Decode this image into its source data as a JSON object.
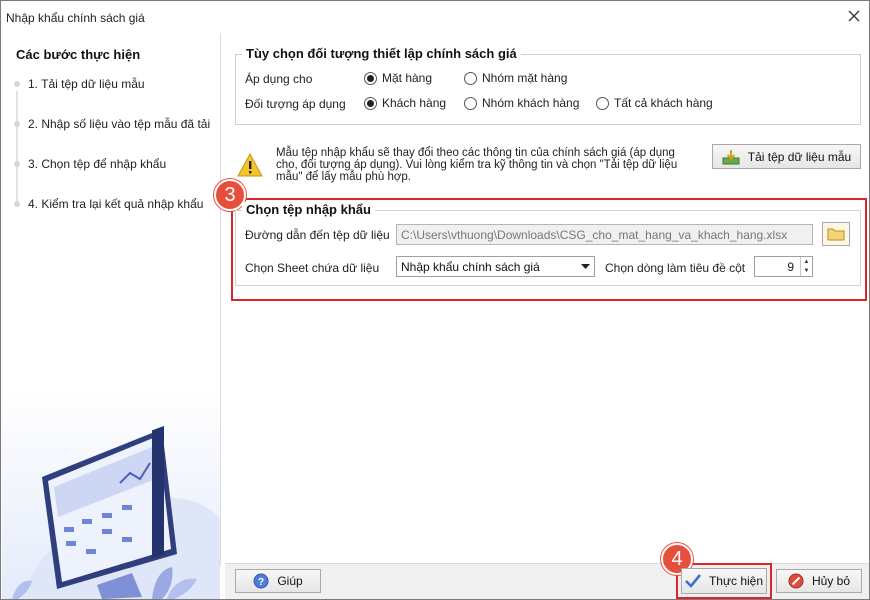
{
  "window": {
    "title": "Nhập khẩu chính sách giá"
  },
  "steps": {
    "title": "Các bước thực hiện",
    "items": [
      "1. Tải tệp dữ liệu mẫu",
      "2. Nhập số liệu vào tệp mẫu đã tải",
      "3. Chọn tệp để nhập khẩu",
      "4. Kiểm tra lại kết quả nhập khẩu"
    ]
  },
  "options": {
    "legend": "Tùy chọn đối tượng thiết lập chính sách giá",
    "apply_label": "Áp dụng cho",
    "apply_choices": [
      "Mặt hàng",
      "Nhóm mặt hàng"
    ],
    "target_label": "Đối tượng áp dụng",
    "target_choices": [
      "Khách hàng",
      "Nhóm khách hàng",
      "Tất cả khách hàng"
    ]
  },
  "notice": {
    "text": "Mẫu tệp nhập khẩu sẽ thay đổi theo các thông tin của chính sách giá (áp dụng cho, đối tượng áp dụng). Vui lòng kiểm tra kỹ thông tin và chọn \"Tải tệp dữ liệu mẫu\" để lấy mẫu phù hợp.",
    "download_button": "Tải tệp dữ liệu mẫu"
  },
  "file_select": {
    "legend": "Chọn tệp nhập khẩu",
    "path_label": "Đường dẫn đến tệp dữ liệu",
    "path_value": "C:\\Users\\vthuong\\Downloads\\CSG_cho_mat_hang_va_khach_hang.xlsx",
    "sheet_label": "Chọn Sheet chứa dữ liệu",
    "sheet_value": "Nhập khẩu chính sách giá",
    "header_row_label": "Chọn dòng làm tiêu đề cột",
    "header_row_value": "9"
  },
  "badges": {
    "step3": "3",
    "step4": "4"
  },
  "footer": {
    "help_button": "Giúp",
    "execute_button": "Thực hiện",
    "cancel_button": "Hủy bỏ"
  },
  "colors": {
    "highlight_red": "#d9262b",
    "badge": "#e84e3c",
    "accent_blue": "#3b6fd6"
  },
  "icons": {
    "close": "close-icon",
    "warning": "warning-icon",
    "download": "download-icon",
    "folder": "folder-icon",
    "help": "help-icon",
    "check": "check-icon",
    "cancel": "cancel-icon"
  }
}
